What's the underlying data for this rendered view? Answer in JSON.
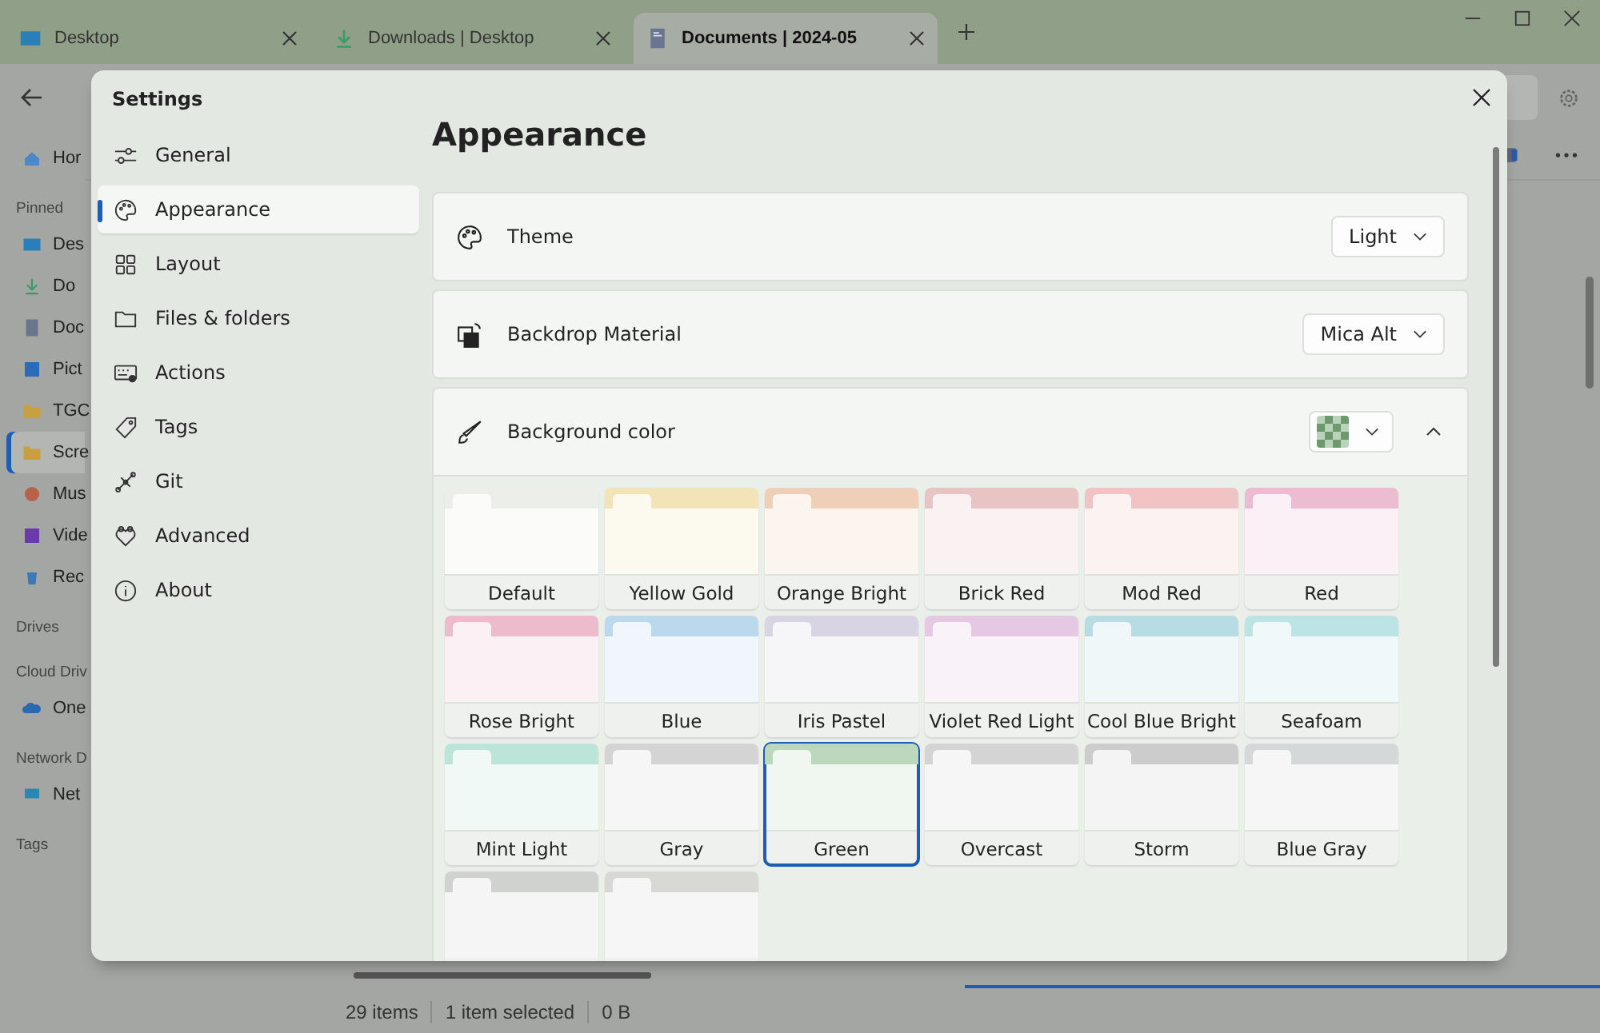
{
  "browser_tabs": [
    {
      "label": "Desktop",
      "selected": false
    },
    {
      "label": "Downloads | Desktop",
      "selected": false
    },
    {
      "label": "Documents | 2024-05",
      "selected": true
    }
  ],
  "sidebar": {
    "items": [
      {
        "kind": "item",
        "label": "Hor",
        "selected": false
      },
      {
        "kind": "header",
        "label": "Pinned"
      },
      {
        "kind": "item",
        "label": "Des",
        "selected": false
      },
      {
        "kind": "item",
        "label": "Do",
        "selected": false
      },
      {
        "kind": "item",
        "label": "Doc",
        "selected": false
      },
      {
        "kind": "item",
        "label": "Pict",
        "selected": false
      },
      {
        "kind": "item",
        "label": "TGC",
        "selected": false
      },
      {
        "kind": "item",
        "label": "Scre",
        "selected": true
      },
      {
        "kind": "item",
        "label": "Mus",
        "selected": false
      },
      {
        "kind": "item",
        "label": "Vide",
        "selected": false
      },
      {
        "kind": "item",
        "label": "Rec",
        "selected": false
      },
      {
        "kind": "header",
        "label": "Drives"
      },
      {
        "kind": "header",
        "label": "Cloud Driv"
      },
      {
        "kind": "item",
        "label": "One",
        "selected": false
      },
      {
        "kind": "header",
        "label": "Network D"
      },
      {
        "kind": "item",
        "label": "Net",
        "selected": false
      },
      {
        "kind": "header",
        "label": "Tags"
      }
    ]
  },
  "status_bar": [
    "29 items",
    "1 item selected",
    "0 B"
  ],
  "settings": {
    "title": "Settings",
    "nav": [
      {
        "label": "General",
        "selected": false
      },
      {
        "label": "Appearance",
        "selected": true
      },
      {
        "label": "Layout",
        "selected": false
      },
      {
        "label": "Files & folders",
        "selected": false
      },
      {
        "label": "Actions",
        "selected": false
      },
      {
        "label": "Tags",
        "selected": false
      },
      {
        "label": "Git",
        "selected": false
      },
      {
        "label": "Advanced",
        "selected": false
      },
      {
        "label": "About",
        "selected": false
      }
    ],
    "heading": "Appearance",
    "cards": [
      {
        "label": "Theme",
        "kind": "dropdown",
        "value": "Light"
      },
      {
        "label": "Backdrop Material",
        "kind": "dropdown",
        "value": "Mica Alt"
      },
      {
        "label": "Background color",
        "kind": "color",
        "expanded": true
      }
    ],
    "colors": [
      {
        "label": "Default",
        "color": "#eceeea",
        "selected": false
      },
      {
        "label": "Yellow Gold",
        "color": "#f3e4b8",
        "selected": false
      },
      {
        "label": "Orange Bright",
        "color": "#f0cfb8",
        "selected": false
      },
      {
        "label": "Brick Red",
        "color": "#e8c4c4",
        "selected": false
      },
      {
        "label": "Mod Red",
        "color": "#f0c4c4",
        "selected": false
      },
      {
        "label": "Red",
        "color": "#ecbcd0",
        "selected": false
      },
      {
        "label": "Rose Bright",
        "color": "#ecbccc",
        "selected": false
      },
      {
        "label": "Blue",
        "color": "#bcd8ec",
        "selected": false
      },
      {
        "label": "Iris Pastel",
        "color": "#d8d4e4",
        "selected": false
      },
      {
        "label": "Violet Red Light",
        "color": "#e4c8e4",
        "selected": false
      },
      {
        "label": "Cool Blue Bright",
        "color": "#b8dce4",
        "selected": false
      },
      {
        "label": "Seafoam",
        "color": "#bce4e4",
        "selected": false
      },
      {
        "label": "Mint Light",
        "color": "#bce4d8",
        "selected": false
      },
      {
        "label": "Gray",
        "color": "#d4d4d4",
        "selected": false
      },
      {
        "label": "Green",
        "color": "#bcd8bc",
        "selected": true
      },
      {
        "label": "Overcast",
        "color": "#d4d4d4",
        "selected": false
      },
      {
        "label": "Storm",
        "color": "#cccccc",
        "selected": false
      },
      {
        "label": "Blue Gray",
        "color": "#d4d8d8",
        "selected": false
      },
      {
        "color": "#d0d2d0",
        "selected": false
      },
      {
        "color": "#d8d8d4",
        "selected": false
      }
    ]
  }
}
